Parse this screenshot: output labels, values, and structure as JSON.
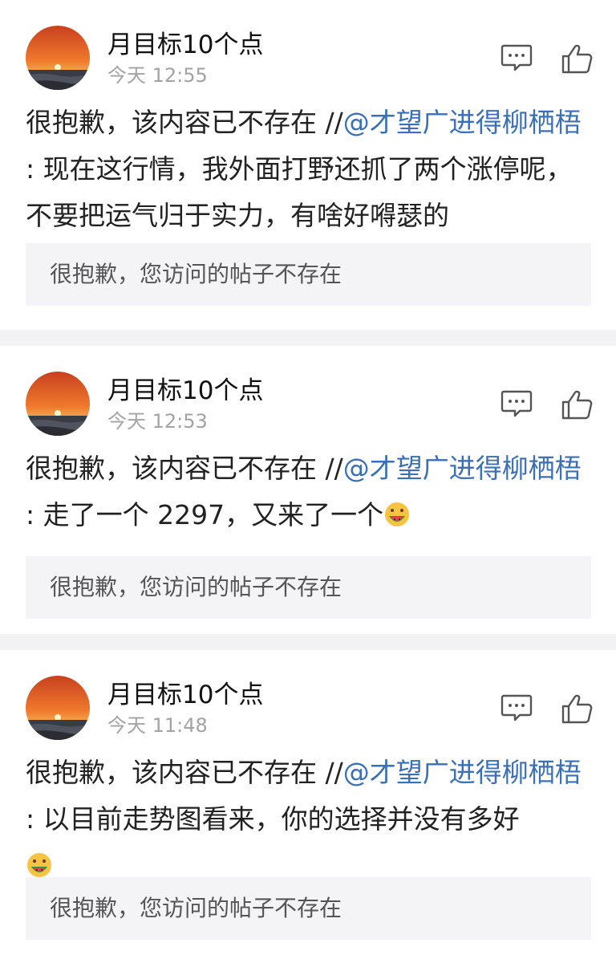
{
  "colors": {
    "mention": "#3b6fb6",
    "timestamp": "#a3a3a3",
    "quote_bg": "#f4f4f6",
    "separator": "#f2f2f4"
  },
  "posts": [
    {
      "username": "月目标10个点",
      "time": "今天 12:55",
      "lead": "很抱歉，该内容已不存在 //",
      "mention": "@才望广进得柳栖梧",
      "body": " : 现在这行情，我外面打野还抓了两个涨停呢，不要把运气归于实力，有啥好嘚瑟的",
      "emoji": "",
      "quote": "很抱歉，您访问的帖子不存在",
      "icons": [
        "comment-icon",
        "like-icon"
      ]
    },
    {
      "username": "月目标10个点",
      "time": "今天 12:53",
      "lead": "很抱歉，该内容已不存在 //",
      "mention": "@才望广进得柳栖梧",
      "body": " : 走了一个 2297，又来了一个",
      "emoji": "watermelon-face-emoji",
      "quote": "很抱歉，您访问的帖子不存在",
      "icons": [
        "comment-icon",
        "like-icon"
      ]
    },
    {
      "username": "月目标10个点",
      "time": "今天 11:48",
      "lead": "很抱歉，该内容已不存在 //",
      "mention": "@才望广进得柳栖梧",
      "body": " : 以目前走势图看来，你的选择并没有多好",
      "emoji": "watermelon-face-emoji",
      "quote": "很抱歉，您访问的帖子不存在",
      "icons": [
        "comment-icon",
        "like-icon"
      ]
    }
  ]
}
